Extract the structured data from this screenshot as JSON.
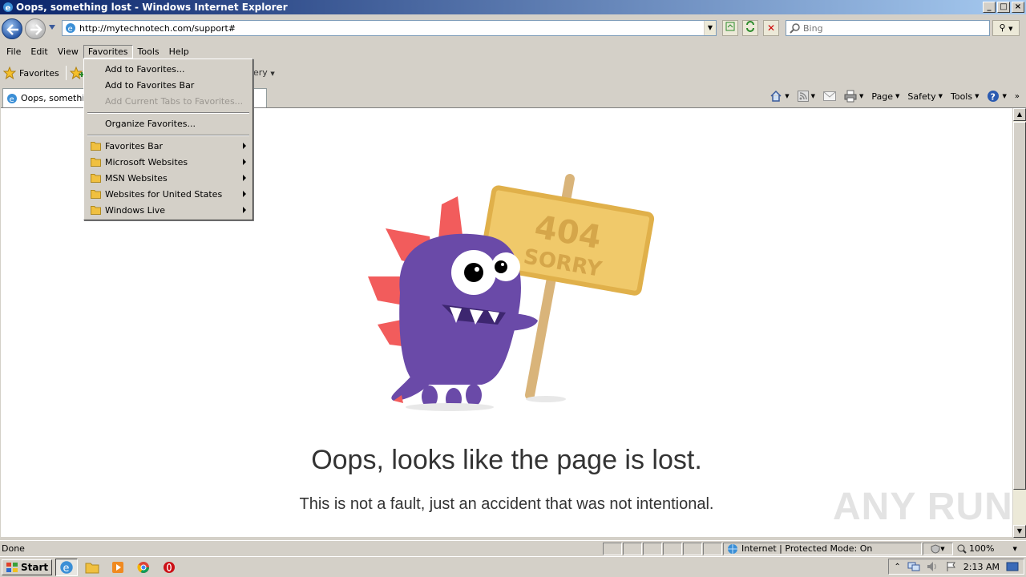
{
  "window": {
    "title": "Oops, something lost - Windows Internet Explorer",
    "controls": [
      "_",
      "□",
      "×"
    ]
  },
  "address_bar": {
    "url": "http://mytechnotech.com/support#",
    "search_placeholder": "Bing"
  },
  "menubar": {
    "items": [
      "File",
      "Edit",
      "View",
      "Favorites",
      "Tools",
      "Help"
    ],
    "active": "Favorites"
  },
  "favorites_bar": {
    "favorites_label": "Favorites",
    "gallery_fragment": "ery"
  },
  "tab": {
    "label": "Oops, something"
  },
  "command_bar": {
    "page_label": "Page",
    "safety_label": "Safety",
    "tools_label": "Tools"
  },
  "favorites_menu": {
    "add_to_favorites": "Add to Favorites...",
    "add_to_favorites_bar": "Add to Favorites Bar",
    "add_current_tabs": "Add Current Tabs to Favorites...",
    "organize_favorites": "Organize Favorites...",
    "folders": [
      "Favorites Bar",
      "Microsoft Websites",
      "MSN Websites",
      "Websites for United States",
      "Windows Live"
    ]
  },
  "page": {
    "sign_line1": "404",
    "sign_line2": "SORRY",
    "headline": "Oops, looks like the page is lost.",
    "subline": "This is not a fault, just an accident that was not intentional.",
    "watermark": "ANY RUN"
  },
  "statusbar": {
    "status": "Done",
    "zone": "Internet | Protected Mode: On",
    "zoom": "100%"
  },
  "taskbar": {
    "start_label": "Start",
    "clock": "2:13 AM"
  },
  "colors": {
    "monster": "#6a4aa8",
    "spikes": "#f25c5c",
    "sign": "#f0c96a",
    "pole": "#d9b47a"
  }
}
